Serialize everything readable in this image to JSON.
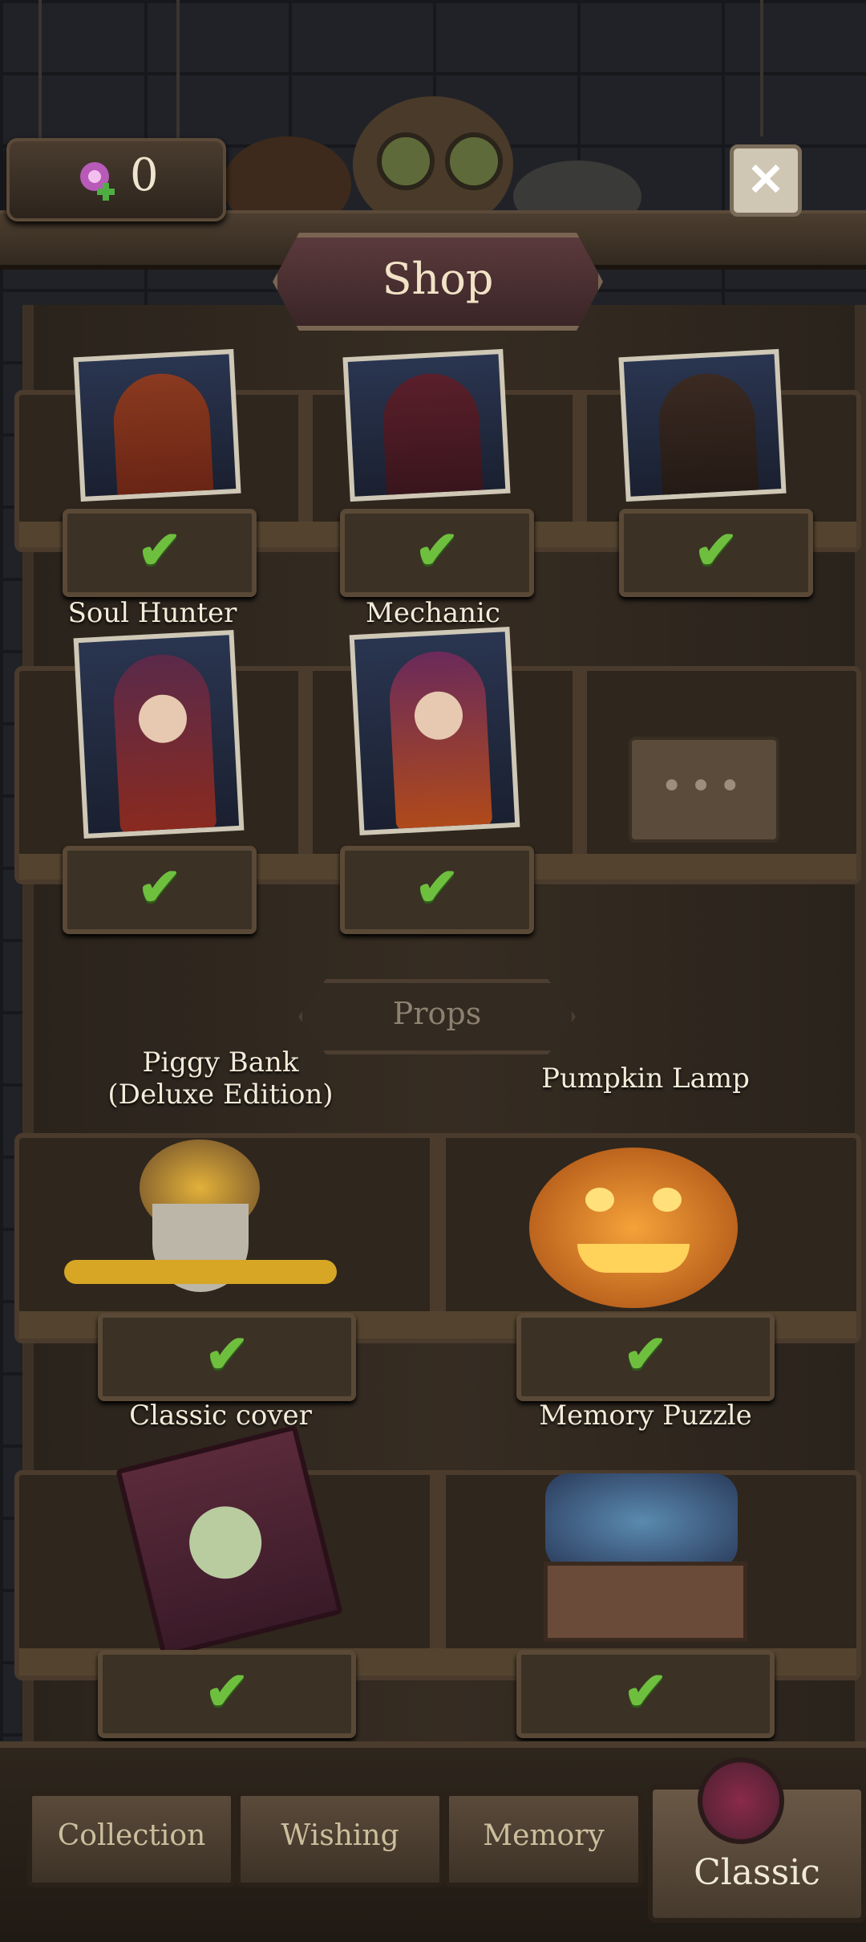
{
  "header": {
    "currency_value": "0",
    "title": "Shop"
  },
  "characters": {
    "row1": [
      "",
      "",
      ""
    ],
    "row2": [
      {
        "name": "Soul Hunter"
      },
      {
        "name": "Mechanic"
      }
    ],
    "more_symbol": "•••"
  },
  "props": {
    "section_title": "Props",
    "items": [
      {
        "name_line1": "Piggy Bank",
        "name_line2": "(Deluxe Edition)"
      },
      {
        "name_line1": "Pumpkin Lamp",
        "name_line2": ""
      },
      {
        "name_line1": "Classic cover",
        "name_line2": ""
      },
      {
        "name_line1": "Memory Puzzle",
        "name_line2": ""
      }
    ]
  },
  "tabs": {
    "collection": "Collection",
    "wishing": "Wishing",
    "memory": "Memory",
    "classic": "Classic"
  },
  "colors": {
    "check": "#6fbf3f",
    "title_bg": "#5b3a3c"
  }
}
